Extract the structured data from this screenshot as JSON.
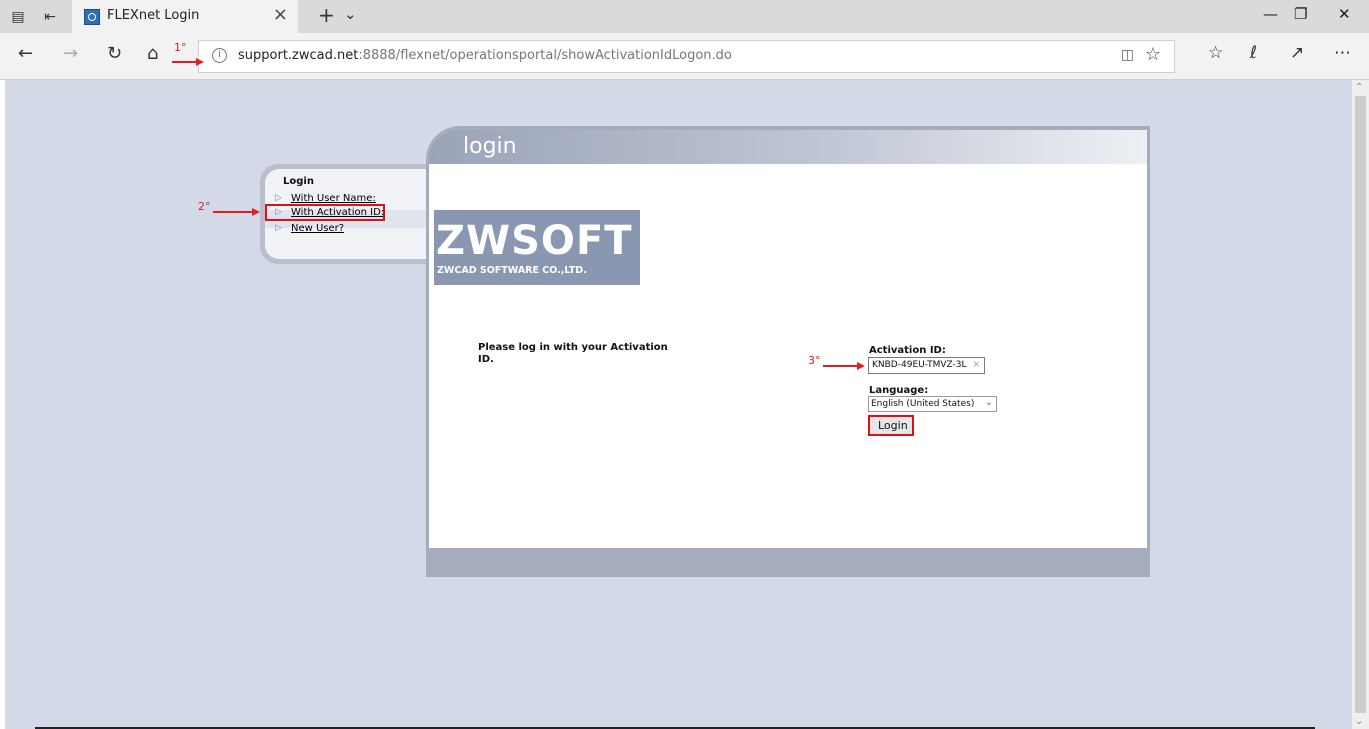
{
  "tab": {
    "title": "FLEXnet Login"
  },
  "address_bar": {
    "host": "support.zwcad.net",
    "path": ":8888/flexnet/operationsportal/showActivationIdLogon.do"
  },
  "left_nav": {
    "heading": "Login",
    "items": [
      {
        "label": "With User Name:"
      },
      {
        "label": "With Activation ID:"
      },
      {
        "label": "New User?"
      }
    ]
  },
  "panel": {
    "title": "login"
  },
  "logo": {
    "big": "ZWSOFT",
    "small": "ZWCAD SOFTWARE CO.,LTD."
  },
  "form": {
    "prompt": "Please log in with your Activation ID.",
    "activation_label": "Activation ID:",
    "activation_value": "KNBD-49EU-TMVZ-3L",
    "language_label": "Language:",
    "language_value": "English (United States)",
    "login_button": "Login"
  },
  "annotations": {
    "step1": "1°",
    "step2": "2°",
    "step3": "3°"
  },
  "colors": {
    "page_bg": "#d3d9e6",
    "annotation_red": "#e02020",
    "panel_frame": "#a4acbd"
  },
  "icons": {
    "tab_actions": "tab-actions-icon",
    "set_aside": "set-aside-tabs-icon",
    "favicon": "flexnet-favicon",
    "back": "back-arrow-icon",
    "forward": "forward-arrow-icon",
    "refresh": "refresh-icon",
    "home": "home-icon",
    "info": "info-icon",
    "reading_view": "reading-view-icon",
    "favorite": "star-icon",
    "favorites_hub": "favorites-list-icon",
    "notes": "pen-icon",
    "share": "share-icon",
    "more": "ellipsis-icon"
  }
}
